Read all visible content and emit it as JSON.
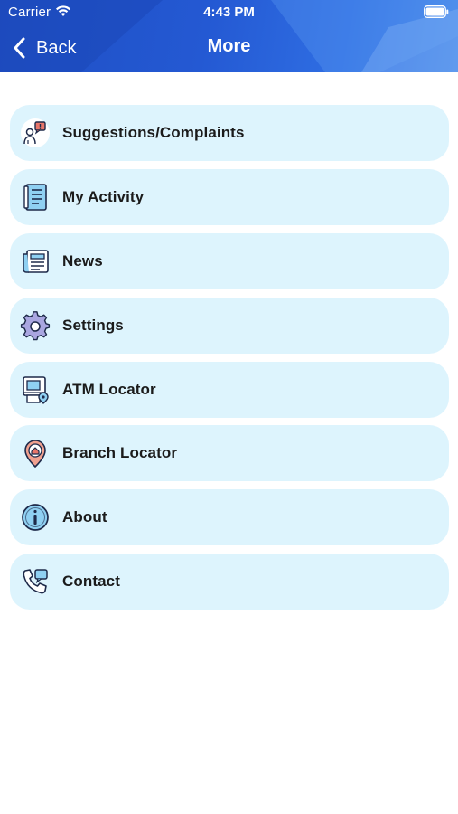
{
  "status_bar": {
    "carrier": "Carrier",
    "time": "4:43 PM"
  },
  "navbar": {
    "back_label": "Back",
    "title": "More"
  },
  "menu": {
    "items": [
      {
        "label": "Suggestions/Complaints",
        "icon": "feedback-icon"
      },
      {
        "label": "My Activity",
        "icon": "activity-icon"
      },
      {
        "label": "News",
        "icon": "news-icon"
      },
      {
        "label": "Settings",
        "icon": "gear-icon"
      },
      {
        "label": "ATM Locator",
        "icon": "atm-location-icon"
      },
      {
        "label": "Branch Locator",
        "icon": "branch-location-icon"
      },
      {
        "label": "About",
        "icon": "info-icon"
      },
      {
        "label": "Contact",
        "icon": "phone-chat-icon"
      }
    ]
  },
  "colors": {
    "header_blue": "#2459d3",
    "item_background": "#ddf4fd",
    "icon_accent_red": "#e8766a",
    "icon_accent_blue": "#8fd0f2",
    "icon_outline": "#1e2a4a"
  }
}
